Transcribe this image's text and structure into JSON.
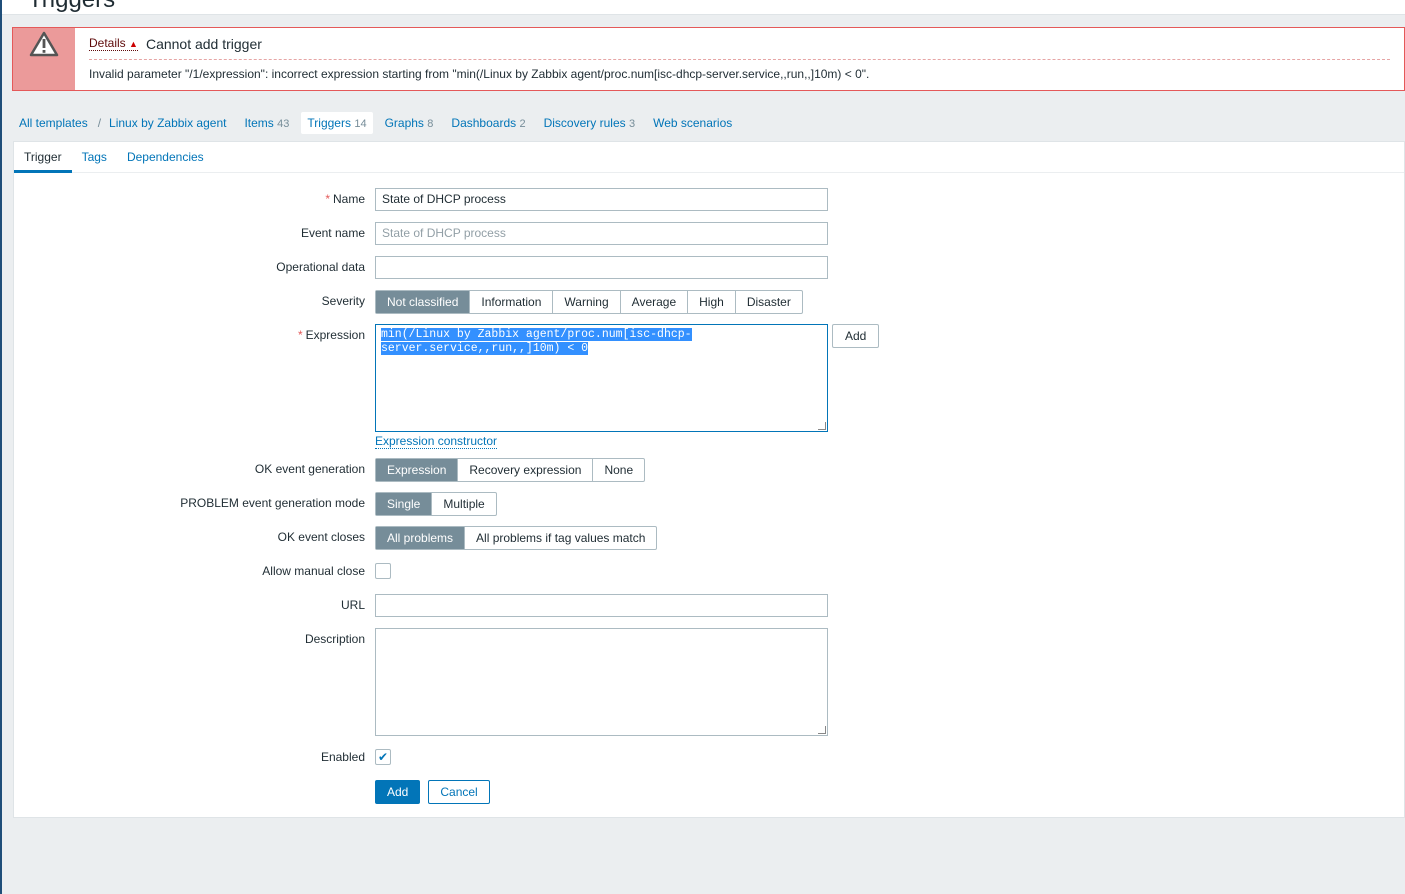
{
  "page_title": "Triggers",
  "error": {
    "details_label": "Details",
    "title": "Cannot add trigger",
    "message": "Invalid parameter \"/1/expression\": incorrect expression starting from \"min(/Linux by Zabbix agent/proc.num[isc-dhcp-server.service,,run,,]10m) < 0\"."
  },
  "nav": {
    "all_templates": "All templates",
    "template": "Linux by Zabbix agent",
    "items": {
      "label": "Items",
      "count": "43"
    },
    "triggers": {
      "label": "Triggers",
      "count": "14"
    },
    "graphs": {
      "label": "Graphs",
      "count": "8"
    },
    "dashboards": {
      "label": "Dashboards",
      "count": "2"
    },
    "discovery": {
      "label": "Discovery rules",
      "count": "3"
    },
    "web": {
      "label": "Web scenarios"
    }
  },
  "tabs": [
    "Trigger",
    "Tags",
    "Dependencies"
  ],
  "form": {
    "name": {
      "label": "Name",
      "value": "State of DHCP process"
    },
    "event_name": {
      "label": "Event name",
      "placeholder": "State of DHCP process"
    },
    "opdata": {
      "label": "Operational data",
      "value": ""
    },
    "severity": {
      "label": "Severity",
      "options": [
        "Not classified",
        "Information",
        "Warning",
        "Average",
        "High",
        "Disaster"
      ],
      "selected": "Not classified"
    },
    "expression": {
      "label": "Expression",
      "line1": "min(/Linux by Zabbix agent/proc.num[isc-dhcp-",
      "line2": "server.service,,run,,]10m) < 0",
      "add": "Add",
      "constructor": "Expression constructor"
    },
    "ok_gen": {
      "label": "OK event generation",
      "options": [
        "Expression",
        "Recovery expression",
        "None"
      ],
      "selected": "Expression"
    },
    "problem_mode": {
      "label": "PROBLEM event generation mode",
      "options": [
        "Single",
        "Multiple"
      ],
      "selected": "Single"
    },
    "ok_closes": {
      "label": "OK event closes",
      "options": [
        "All problems",
        "All problems if tag values match"
      ],
      "selected": "All problems"
    },
    "manual_close": {
      "label": "Allow manual close",
      "checked": false
    },
    "url": {
      "label": "URL",
      "value": ""
    },
    "description": {
      "label": "Description",
      "value": ""
    },
    "enabled": {
      "label": "Enabled",
      "checked": true
    },
    "add": "Add",
    "cancel": "Cancel"
  }
}
